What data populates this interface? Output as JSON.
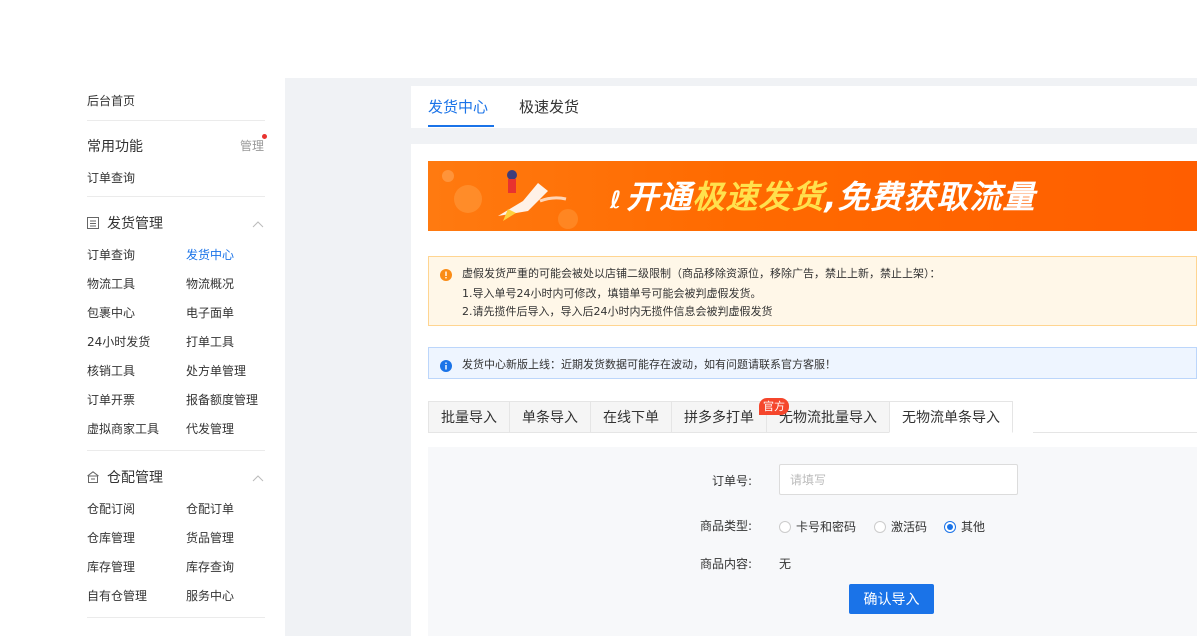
{
  "sidebar": {
    "home": "后台首页",
    "common": {
      "title": "常用功能",
      "manage": "管理",
      "item": "订单查询"
    },
    "shipping": {
      "title": "发货管理",
      "items": [
        "订单查询",
        "发货中心",
        "物流工具",
        "物流概况",
        "包裹中心",
        "电子面单",
        "24小时发货",
        "打单工具",
        "核销工具",
        "处方单管理",
        "订单开票",
        "报备额度管理",
        "虚拟商家工具",
        "代发管理"
      ]
    },
    "warehouse": {
      "title": "仓配管理",
      "items": [
        "仓配订阅",
        "仓配订单",
        "仓库管理",
        "货品管理",
        "库存管理",
        "库存查询",
        "自有仓管理",
        "服务中心"
      ]
    }
  },
  "top_tabs": [
    "发货中心",
    "极速发货"
  ],
  "banner": {
    "prefix": "开通",
    "highlight": "极速发货",
    "suffix": ",免费获取流量"
  },
  "warning": {
    "lines": [
      "虚假发货严重的可能会被处以店铺二级限制（商品移除资源位，移除广告，禁止上新，禁止上架）：",
      "1.导入单号24小时内可修改，填错单号可能会被判虚假发货。",
      "2.请先揽件后导入，导入后24小时内无揽件信息会被判虚假发货"
    ]
  },
  "info": "发货中心新版上线：近期发货数据可能存在波动，如有问题请联系官方客服！",
  "sub_tabs": [
    "批量导入",
    "单条导入",
    "在线下单",
    "拼多多打单",
    "无物流批量导入",
    "无物流单条导入"
  ],
  "badge": "官方",
  "form": {
    "order_label": "订单号:",
    "order_placeholder": "请填写",
    "type_label": "商品类型:",
    "type_options": [
      "卡号和密码",
      "激活码",
      "其他"
    ],
    "content_label": "商品内容:",
    "content_value": "无",
    "submit": "确认导入"
  },
  "colors": {
    "accent": "#1a73e8",
    "banner": "#ff6a00",
    "badge": "#f5462c"
  }
}
